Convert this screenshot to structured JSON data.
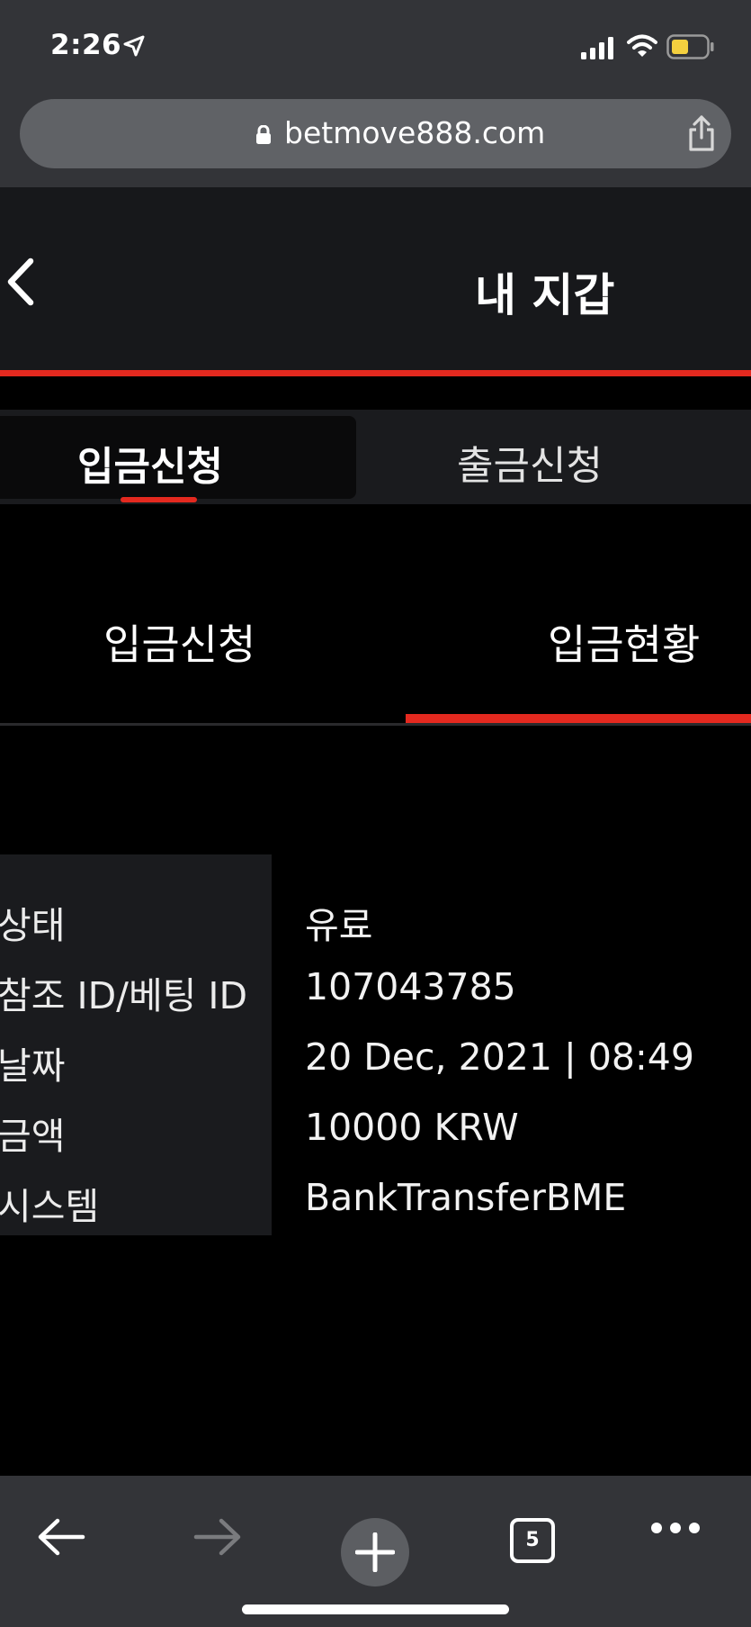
{
  "status_bar": {
    "time": "2:26",
    "location_icon": "location-arrow-icon",
    "signal_icon": "cellular-signal-icon",
    "wifi_icon": "wifi-icon",
    "battery_icon": "battery-icon",
    "battery_color": "#f4d03f"
  },
  "browser": {
    "url": "betmove888.com",
    "lock_icon": "lock-icon",
    "share_icon": "share-icon"
  },
  "header": {
    "title": "내 지갑",
    "back_icon": "chevron-left-icon",
    "accent_color": "#e4291f"
  },
  "main_tabs": [
    {
      "label": "입금신청",
      "active": true
    },
    {
      "label": "출금신청",
      "active": false
    }
  ],
  "sub_tabs": [
    {
      "label": "입금신청",
      "active": false
    },
    {
      "label": "입금현황",
      "active": true
    }
  ],
  "details": [
    {
      "label": "상태",
      "value": "유료"
    },
    {
      "label": "참조 ID/베팅 ID",
      "value": "107043785"
    },
    {
      "label": "날짜",
      "value": "20 Dec, 2021 | 08:49"
    },
    {
      "label": "금액",
      "value": "10000 KRW"
    },
    {
      "label": "시스템",
      "value": "BankTransferBME"
    }
  ],
  "toolbar": {
    "back_icon": "arrow-left-icon",
    "forward_icon": "arrow-right-icon",
    "new_tab_icon": "plus-icon",
    "tab_count": "5",
    "more_icon": "more-dots-icon"
  }
}
